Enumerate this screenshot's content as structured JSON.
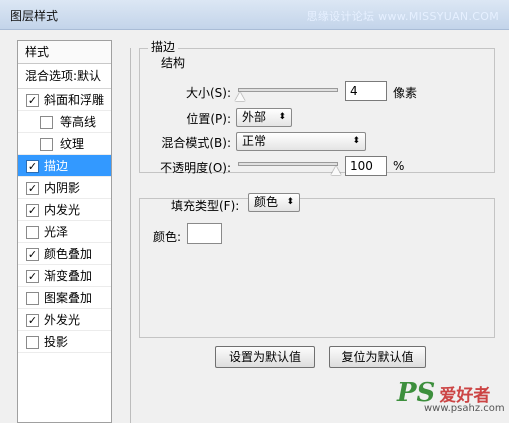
{
  "window": {
    "title": "图层样式",
    "watermark": "思缘设计论坛 www.MISSYUAN.COM"
  },
  "sidebar": {
    "header": "样式",
    "blend_options": "混合选项:默认",
    "items": [
      {
        "label": "斜面和浮雕",
        "checked": true
      },
      {
        "label": "等高线",
        "checked": false
      },
      {
        "label": "纹理",
        "checked": false
      },
      {
        "label": "描边",
        "checked": true
      },
      {
        "label": "内阴影",
        "checked": true
      },
      {
        "label": "内发光",
        "checked": true
      },
      {
        "label": "光泽",
        "checked": false
      },
      {
        "label": "颜色叠加",
        "checked": true
      },
      {
        "label": "渐变叠加",
        "checked": true
      },
      {
        "label": "图案叠加",
        "checked": false
      },
      {
        "label": "外发光",
        "checked": true
      },
      {
        "label": "投影",
        "checked": false
      }
    ]
  },
  "stroke": {
    "section_title": "描边",
    "structure_title": "结构",
    "size_label": "大小(S):",
    "size_value": "4",
    "size_unit": "像素",
    "size_slider": 0.0,
    "position_label": "位置(P):",
    "position_value": "外部",
    "blend_label": "混合模式(B):",
    "blend_value": "正常",
    "opacity_label": "不透明度(O):",
    "opacity_value": "100",
    "opacity_unit": "%",
    "opacity_slider": 1.0,
    "fill_type_label": "填充类型(F):",
    "fill_type_value": "颜色",
    "color_label": "颜色:",
    "color_value": "#ffffff"
  },
  "buttons": {
    "set_default": "设置为默认值",
    "reset_default": "复位为默认值"
  },
  "watermark_bottom": {
    "ps": "PS",
    "cn": "爱好者",
    "url": "www.psahz.com"
  }
}
